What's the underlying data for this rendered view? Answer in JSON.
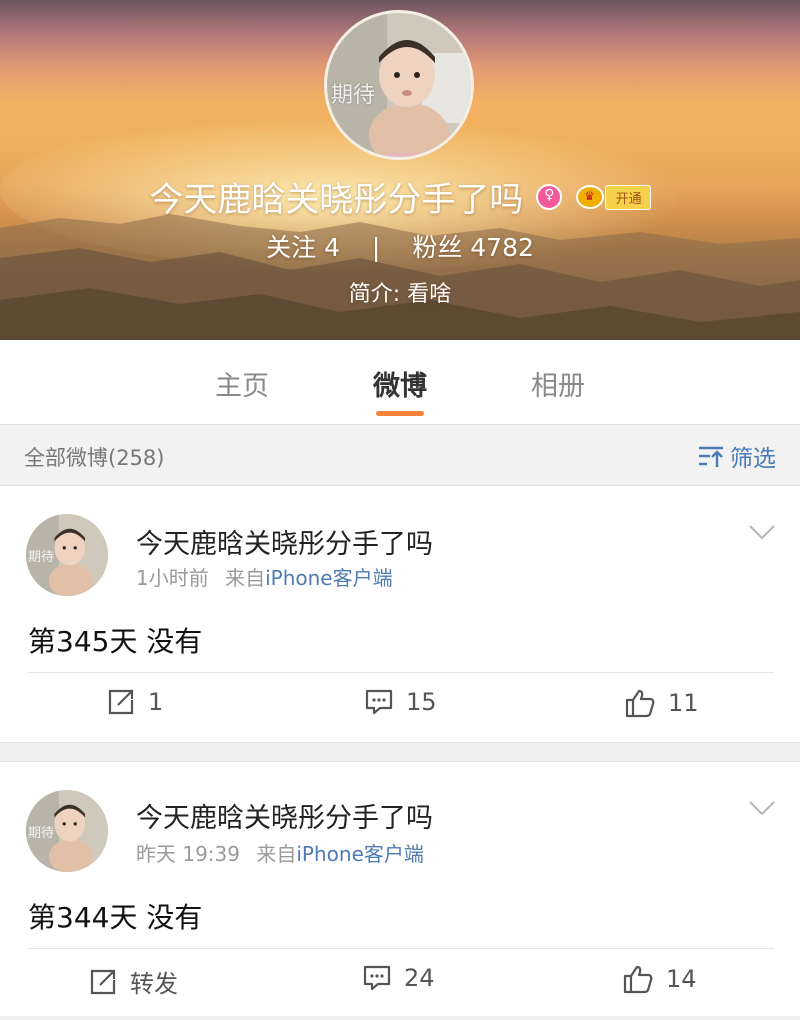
{
  "profile": {
    "avatar_overlay_text": "期待",
    "name": "今天鹿晗关晓彤分手了吗",
    "gender_icon": "female-icon",
    "vip_label": "开通",
    "following_label": "关注",
    "following_count": "4",
    "separator": "|",
    "followers_label": "粉丝",
    "followers_count": "4782",
    "bio": "简介: 看啥"
  },
  "tabs": [
    {
      "label": "主页",
      "active": false
    },
    {
      "label": "微博",
      "active": true
    },
    {
      "label": "相册",
      "active": false
    }
  ],
  "filter": {
    "count_label": "全部微博(258)",
    "button_label": "筛选"
  },
  "posts": [
    {
      "author": "今天鹿晗关晓彤分手了吗",
      "avatar_overlay_text": "期待",
      "time": "1小时前",
      "source_prefix": "来自",
      "source": "iPhone客户端",
      "text": "第345天 没有",
      "repost": "1",
      "comments": "15",
      "likes": "11"
    },
    {
      "author": "今天鹿晗关晓彤分手了吗",
      "avatar_overlay_text": "期待",
      "time": "昨天 19:39",
      "source_prefix": "来自",
      "source": "iPhone客户端",
      "text": "第344天 没有",
      "repost": "转发",
      "comments": "24",
      "likes": "14"
    }
  ],
  "colors": {
    "accent_orange": "#f7823a",
    "link_blue": "#4f7bb3",
    "female_pink": "#f25a9c",
    "vip_gold": "#f1b000"
  }
}
